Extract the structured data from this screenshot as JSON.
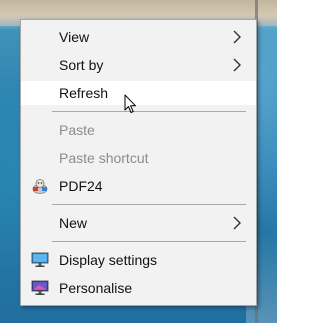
{
  "context_menu": {
    "items": [
      {
        "label": "View",
        "has_submenu": true,
        "enabled": true,
        "icon": "",
        "highlighted": false
      },
      {
        "label": "Sort by",
        "has_submenu": true,
        "enabled": true,
        "icon": "",
        "highlighted": false
      },
      {
        "label": "Refresh",
        "has_submenu": false,
        "enabled": true,
        "icon": "",
        "highlighted": true
      },
      {
        "label": "Paste",
        "has_submenu": false,
        "enabled": false,
        "icon": "",
        "highlighted": false
      },
      {
        "label": "Paste shortcut",
        "has_submenu": false,
        "enabled": false,
        "icon": "",
        "highlighted": false
      },
      {
        "label": "PDF24",
        "has_submenu": false,
        "enabled": true,
        "icon": "pdf24-icon",
        "highlighted": false
      },
      {
        "label": "New",
        "has_submenu": true,
        "enabled": true,
        "icon": "",
        "highlighted": false
      },
      {
        "label": "Display settings",
        "has_submenu": false,
        "enabled": true,
        "icon": "display-settings-icon",
        "highlighted": false
      },
      {
        "label": "Personalise",
        "has_submenu": false,
        "enabled": true,
        "icon": "personalise-icon",
        "highlighted": false
      }
    ]
  },
  "colors": {
    "menu_background": "#f2f2f2",
    "highlight_background": "#ffffff",
    "enabled_text": "#111111",
    "disabled_text": "#8c8c8c",
    "separator": "#a9a9a9"
  }
}
